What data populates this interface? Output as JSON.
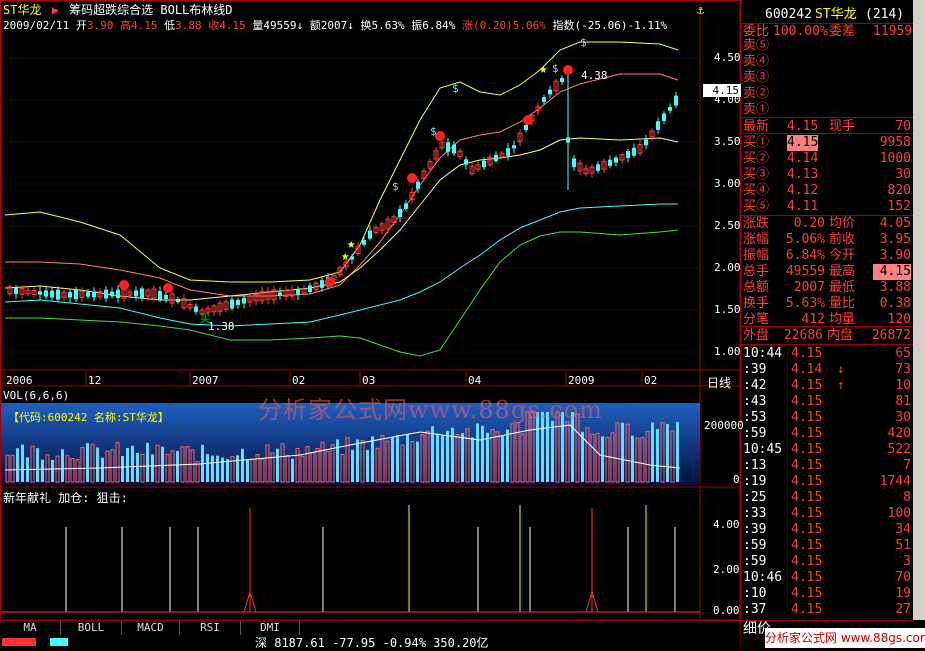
{
  "header": {
    "stock_name": "ST华龙",
    "indicators": "筹码超跌综合选 BOLL布林线D",
    "date": "2009/02/11",
    "open_label": "开",
    "open": "3.90",
    "high_label": "高",
    "high": "4.15",
    "low_label": "低",
    "low": "3.88",
    "close_label": "收",
    "close": "4.15",
    "volume_label": "量",
    "volume": "49559",
    "amount_label": "额",
    "amount": "2007",
    "turnover_label": "换",
    "turnover": "5.63%",
    "amplitude_label": "振",
    "amplitude": "6.84%",
    "change_label": "涨",
    "change": "(0.20)5.06%",
    "index_label": "指数",
    "index": "(-25.06)-1.11%"
  },
  "price_axis": [
    "4.50",
    "4.00",
    "3.50",
    "3.00",
    "2.50",
    "2.00",
    "1.50",
    "1.00"
  ],
  "price_tag": "4.15",
  "annotations": {
    "high_mark": "4.38",
    "low_mark": "1.38",
    "buy_text": "买"
  },
  "time_axis": {
    "labels": [
      "2006",
      "12",
      "2007",
      "02",
      "03",
      "04",
      "2009",
      "02"
    ],
    "period": "日线"
  },
  "volume_panel": {
    "title": "VOL(6,6,6)",
    "info": "【代码:600242 名称:ST华龙】",
    "axis": [
      "200000",
      "0"
    ],
    "watermark": "分析家公式网www.88gs.com"
  },
  "indicator_panel": {
    "title": "新年献礼 加仓: 狙击:",
    "axis": [
      "4.00",
      "2.00",
      "0.00"
    ]
  },
  "bottom_tabs": [
    "MA",
    "BOLL",
    "MACD",
    "RSI",
    "DMI"
  ],
  "status_bar": "深 8187.61 -77.95 -0.94% 350.20亿",
  "quote": {
    "code": "600242",
    "name": "ST华龙",
    "num": "(214)",
    "weibi_label": "委比",
    "weibi": "100.00%",
    "weicha_label": "委差",
    "weicha": "11959",
    "sells": [
      "卖⑤",
      "卖④",
      "卖③",
      "卖②",
      "卖①"
    ],
    "last_label": "最新",
    "last": "4.15",
    "now_label": "现手",
    "now": "70",
    "buys": [
      {
        "label": "买①",
        "price": "4.15",
        "vol": "9958"
      },
      {
        "label": "买②",
        "price": "4.14",
        "vol": "1000"
      },
      {
        "label": "买③",
        "price": "4.13",
        "vol": "30"
      },
      {
        "label": "买④",
        "price": "4.12",
        "vol": "820"
      },
      {
        "label": "买⑤",
        "price": "4.11",
        "vol": "152"
      }
    ],
    "stats": [
      {
        "l1": "涨跌",
        "v1": "0.20",
        "l2": "均价",
        "v2": "4.05"
      },
      {
        "l1": "涨幅",
        "v1": "5.06%",
        "l2": "前收",
        "v2": "3.95"
      },
      {
        "l1": "振幅",
        "v1": "6.84%",
        "l2": "今开",
        "v2": "3.90"
      },
      {
        "l1": "总手",
        "v1": "49559",
        "l2": "最高",
        "v2": "4.15"
      },
      {
        "l1": "总额",
        "v1": "2007",
        "l2": "最低",
        "v2": "3.88"
      },
      {
        "l1": "换手",
        "v1": "5.63%",
        "l2": "量比",
        "v2": "0.38"
      },
      {
        "l1": "分笔",
        "v1": "412",
        "l2": "均量",
        "v2": "120"
      }
    ],
    "outer_label": "外盘",
    "outer": "22686",
    "inner_label": "内盘",
    "inner": "26872"
  },
  "ticks": [
    {
      "t": "10:44",
      "p": "4.15",
      "a": "",
      "v": "65"
    },
    {
      "t": ":39",
      "p": "4.14",
      "a": "↓",
      "v": "73"
    },
    {
      "t": ":42",
      "p": "4.15",
      "a": "↑",
      "v": "10"
    },
    {
      "t": ":43",
      "p": "4.15",
      "a": "",
      "v": "81"
    },
    {
      "t": ":53",
      "p": "4.15",
      "a": "",
      "v": "30"
    },
    {
      "t": ":59",
      "p": "4.15",
      "a": "",
      "v": "420"
    },
    {
      "t": "10:45",
      "p": "4.15",
      "a": "",
      "v": "522"
    },
    {
      "t": ":13",
      "p": "4.15",
      "a": "",
      "v": "7"
    },
    {
      "t": ":19",
      "p": "4.15",
      "a": "",
      "v": "1744"
    },
    {
      "t": ":25",
      "p": "4.15",
      "a": "",
      "v": "8"
    },
    {
      "t": ":33",
      "p": "4.15",
      "a": "",
      "v": "100"
    },
    {
      "t": ":39",
      "p": "4.15",
      "a": "",
      "v": "34"
    },
    {
      "t": ":59",
      "p": "4.15",
      "a": "",
      "v": "51"
    },
    {
      "t": ":59",
      "p": "4.15",
      "a": "",
      "v": "3"
    },
    {
      "t": "10:46",
      "p": "4.15",
      "a": "",
      "v": "70"
    },
    {
      "t": ":10",
      "p": "4.15",
      "a": "",
      "v": "19"
    },
    {
      "t": ":37",
      "p": "4.15",
      "a": "",
      "v": "27"
    }
  ],
  "bottom_right": "细价",
  "bottom_watermark": "分析家公式网 www.88gs.com",
  "colors": {
    "up": "#ff3c3c",
    "down": "#40ffff",
    "frame": "#a00000"
  }
}
